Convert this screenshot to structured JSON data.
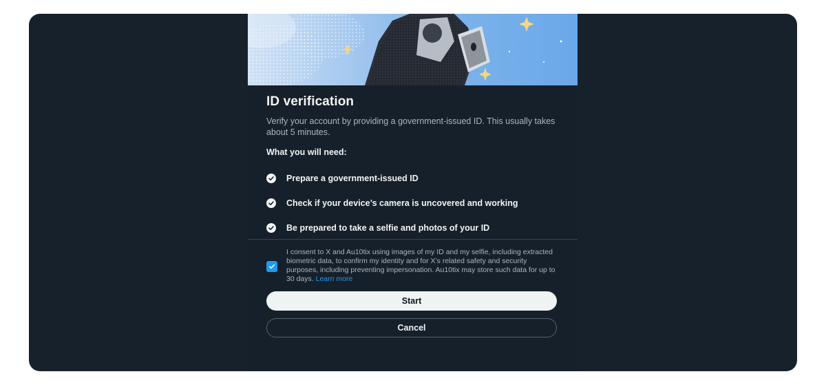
{
  "dialog": {
    "title": "ID verification",
    "subtitle": "Verify your account by providing a government-issued ID. This usually takes about 5 minutes.",
    "need_label": "What you will need:",
    "requirements": [
      {
        "icon": "check-circle-icon",
        "label": "Prepare a government-issued ID"
      },
      {
        "icon": "check-circle-icon",
        "label": "Check if your device’s camera is uncovered and working"
      },
      {
        "icon": "check-circle-icon",
        "label": "Be prepared to take a selfie and photos of your ID"
      }
    ],
    "consent": {
      "checked": true,
      "text": "I consent to X and Au10tix using images of my ID and my selfie, including extracted biometric data, to confirm my identity and for X’s related safety and security purposes, including preventing impersonation. Au10tix may store such data for up to 30 days.",
      "learn_more": "Learn more"
    },
    "start_label": "Start",
    "cancel_label": "Cancel"
  },
  "colors": {
    "background": "#17212b",
    "accent": "#1d9bf0",
    "text_primary": "#f2f4f6",
    "text_secondary": "#aab6c1",
    "primary_button_bg": "#eff3f4"
  }
}
